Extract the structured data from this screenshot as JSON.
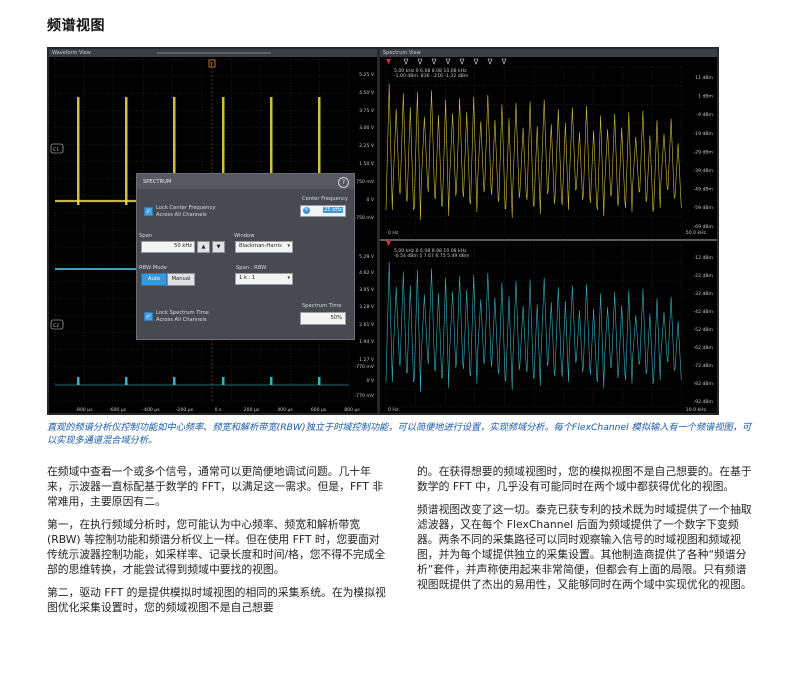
{
  "heading": "频谱视图",
  "screen": {
    "waveform": {
      "title": "Waveform View",
      "channel_labels": [
        "C1",
        "C2"
      ],
      "trigger_marker": "T",
      "ytick_labels": [
        "5.25 V",
        "4.50 V",
        "3.75 V",
        "3.00 V",
        "2.25 V",
        "1.50 V",
        "750 mV",
        "0 V",
        "-750 mV",
        "5.29 V",
        "4.62 V",
        "3.95 V",
        "3.28 V",
        "2.61 V",
        "1.94 V",
        "1.27 V",
        "-770 mV",
        "0 V",
        "-770 mV"
      ],
      "xtick_labels": [
        "-800 µs",
        "-600 µs",
        "-400 µs",
        "-200 µs",
        "0 s",
        "200 µs",
        "400 µs",
        "600 µs",
        "800 µs"
      ]
    },
    "spectrum": {
      "title": "Spectrum View",
      "readout1": [
        "5.00 kHz  0  6.08  8.08  10.08 kHz",
        "-1.00 dBm  .836  -.216  -1.32 dBm"
      ],
      "readout2": [
        "5.00 kHz  0  6.08  8.08  10.08 kHz",
        "-0.54 dBm  5  7.67  6.75  5.49 dBm"
      ],
      "ytick_top": [
        "11 dBm",
        "1 dBm",
        "-9 dBm",
        "-19 dBm",
        "-29 dBm",
        "-39 dBm",
        "-49 dBm",
        "-59 dBm",
        "-69 dBm"
      ],
      "ytick_bottom": [
        "-12 dBm",
        "-22 dBm",
        "-32 dBm",
        "-42 dBm",
        "-52 dBm",
        "-62 dBm",
        "-72 dBm",
        "-82 dBm",
        "-92 dBm"
      ],
      "x_start": "0 Hz",
      "x_end_top": "50.0 kHz",
      "x_end_bottom": "10.0 kHz"
    },
    "dialog": {
      "title": "SPECTRUM",
      "help": "?",
      "lock_center_label": "Lock Center Frequency\nAcross All Channels",
      "center_frequency_label": "Center Frequency",
      "center_frequency_value": "25 kHz",
      "span_label": "Span",
      "span_value": "50 kHz",
      "window_label": "Window",
      "window_value": "Blackman-Harris",
      "rbw_mode_label": "RBW Mode",
      "rbw_auto": "Auto",
      "rbw_manual": "Manual",
      "span_rbw_label": "Span : RBW",
      "span_rbw_value": "1 k : 1",
      "lock_time_label": "Lock Spectrum Time\nAcross All Channels",
      "spectrum_time_label": "Spectrum Time",
      "spectrum_time_value": "50%"
    },
    "colors": {
      "ch1": "#e8d44a",
      "ch2": "#3ec6d6",
      "accent": "#3a97d9"
    }
  },
  "caption": "直观的频谱分析仪控制功能如中心频率、频宽和解析带宽(RBW)独立于时域控制功能，可以简便地进行设置，实现频域分析。每个FlexChannel 模拟输入有一个频谱视图，可以实现多通道混合域分析。",
  "left_column": [
    "在频域中查看一个或多个信号，通常可以更简便地调试问题。几十年来，示波器一直标配基于数学的 FFT，以满足这一需求。但是，FFT 非常难用，主要原因有二。",
    "第一，在执行频域分析时，您可能认为中心频率、频宽和解析带宽 (RBW) 等控制功能和频谱分析仪上一样。但在使用 FFT 时，您要面对传统示波器控制功能，如采样率、记录长度和时间/格，您不得不完成全部的思维转换，才能尝试得到频域中要找的视图。",
    "第二，驱动 FFT 的是提供模拟时域视图的相同的采集系统。在为模拟视图优化采集设置时，您的频域视图不是自己想要"
  ],
  "right_column": [
    "的。在获得想要的频域视图时，您的模拟视图不是自己想要的。在基于数学的 FFT 中，几乎没有可能同时在两个域中都获得优化的视图。",
    "频谱视图改变了这一切。泰克已获专利的技术既为时域提供了一个抽取滤波器，又在每个 FlexChannel 后面为频域提供了一个数字下变频器。两条不同的采集路径可以同时观察输入信号的时域视图和频域视图，并为每个域提供独立的采集设置。其他制造商提供了各种“频谱分析”套件，并声称使用起来非常简便，但都会有上面的局限。只有频谱视图既提供了杰出的易用性，又能够同时在两个域中实现优化的视图。"
  ]
}
